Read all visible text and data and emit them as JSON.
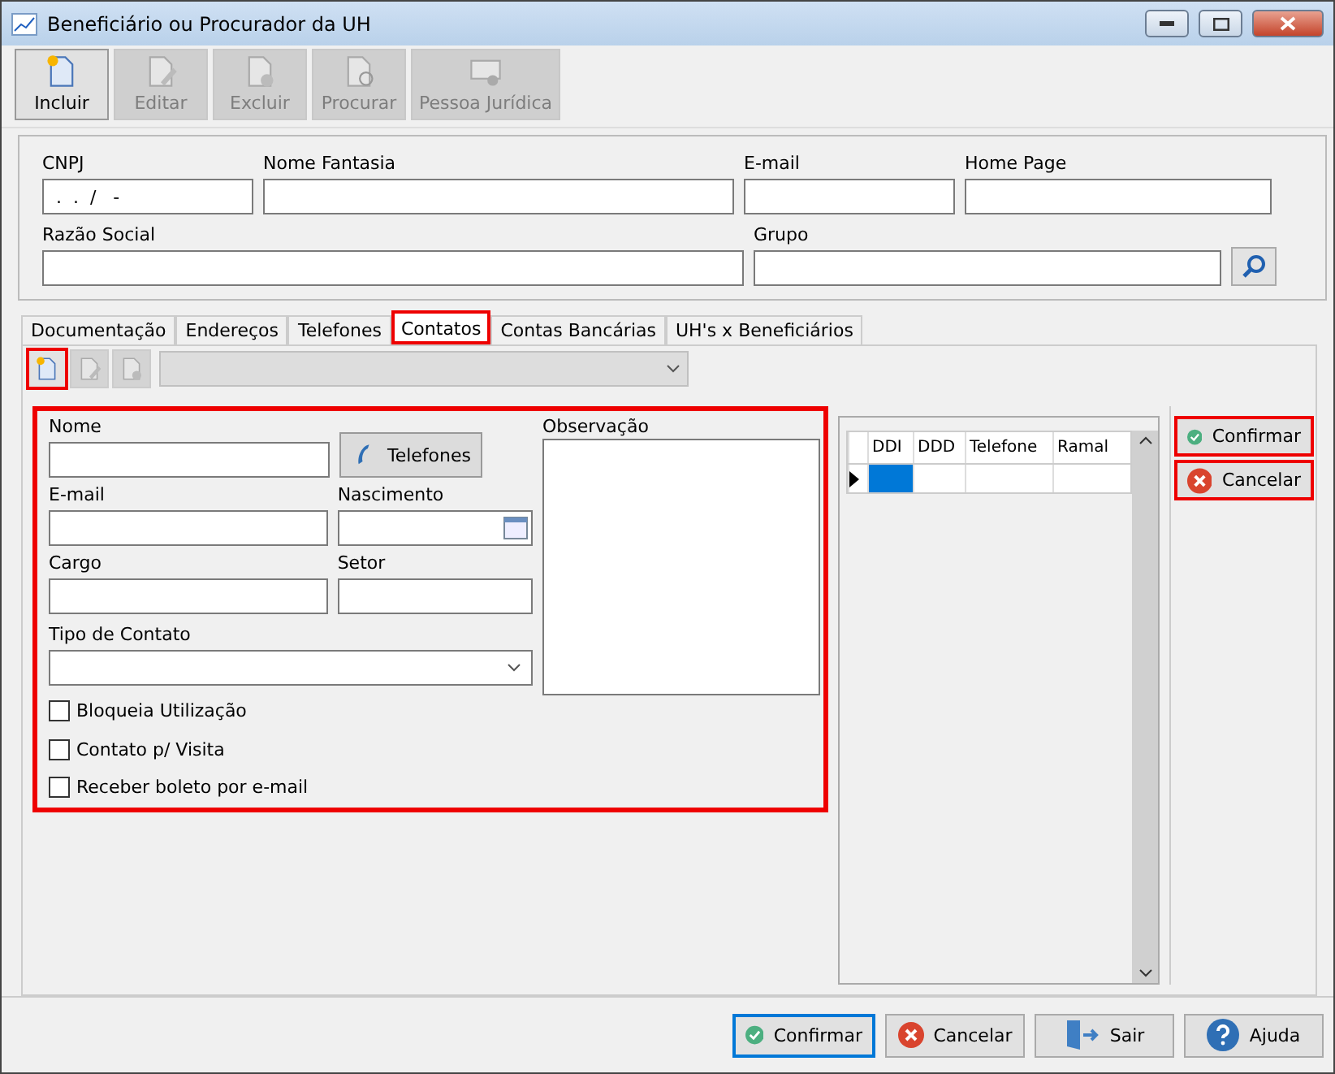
{
  "window": {
    "title": "Beneficiário ou Procurador da UH"
  },
  "toolbar": [
    {
      "label": "Incluir",
      "kind": "new",
      "disabled": false
    },
    {
      "label": "Editar",
      "kind": "edit",
      "disabled": true
    },
    {
      "label": "Excluir",
      "kind": "delete",
      "disabled": true
    },
    {
      "label": "Procurar",
      "kind": "find",
      "disabled": true
    },
    {
      "label": "Pessoa Jurídica",
      "kind": "card",
      "disabled": true
    }
  ],
  "header": {
    "cnpj": {
      "label": "CNPJ",
      "value": " .  .  /   -"
    },
    "nome_fantasia": {
      "label": "Nome Fantasia"
    },
    "email": {
      "label": "E-mail"
    },
    "home_page": {
      "label": "Home Page"
    },
    "razao_social": {
      "label": "Razão Social"
    },
    "grupo": {
      "label": "Grupo"
    }
  },
  "tabs": [
    {
      "label": "Documentação",
      "selected": false,
      "highlighted": false
    },
    {
      "label": "Endereços",
      "selected": false,
      "highlighted": false
    },
    {
      "label": "Telefones",
      "selected": false,
      "highlighted": false
    },
    {
      "label": "Contatos",
      "selected": true,
      "highlighted": true
    },
    {
      "label": "Contas Bancárias",
      "selected": false,
      "highlighted": false
    },
    {
      "label": "UH's x Beneficiários",
      "selected": false,
      "highlighted": false
    }
  ],
  "contact_toolbar": [
    {
      "kind": "new",
      "disabled": false,
      "highlighted": true
    },
    {
      "kind": "edit",
      "disabled": true,
      "highlighted": false
    },
    {
      "kind": "delete",
      "disabled": true,
      "highlighted": false
    }
  ],
  "contact_form": {
    "highlighted": true,
    "nome": {
      "label": "Nome"
    },
    "telefones_button": "Telefones",
    "email": {
      "label": "E-mail"
    },
    "nascimento": {
      "label": "Nascimento"
    },
    "cargo": {
      "label": "Cargo"
    },
    "setor": {
      "label": "Setor"
    },
    "tipo_contato": {
      "label": "Tipo de Contato"
    },
    "observacao": {
      "label": "Observação"
    },
    "checkboxes": [
      {
        "label": "Bloqueia Utilização",
        "checked": false
      },
      {
        "label": "Contato p/ Visita",
        "checked": false
      },
      {
        "label": "Receber boleto por e-mail",
        "checked": false
      }
    ]
  },
  "phone_table": {
    "columns": [
      "DDI",
      "DDD",
      "Telefone",
      "Ramal"
    ]
  },
  "side_buttons": [
    {
      "label": "Confirmar",
      "kind": "confirm",
      "highlighted": true
    },
    {
      "label": "Cancelar",
      "kind": "cancel",
      "highlighted": true
    }
  ],
  "footer_buttons": [
    {
      "label": "Confirmar",
      "kind": "confirm",
      "selected": true
    },
    {
      "label": "Cancelar",
      "kind": "cancel",
      "selected": false
    },
    {
      "label": "Sair",
      "kind": "exit",
      "selected": false
    },
    {
      "label": "Ajuda",
      "kind": "help",
      "selected": false
    }
  ]
}
